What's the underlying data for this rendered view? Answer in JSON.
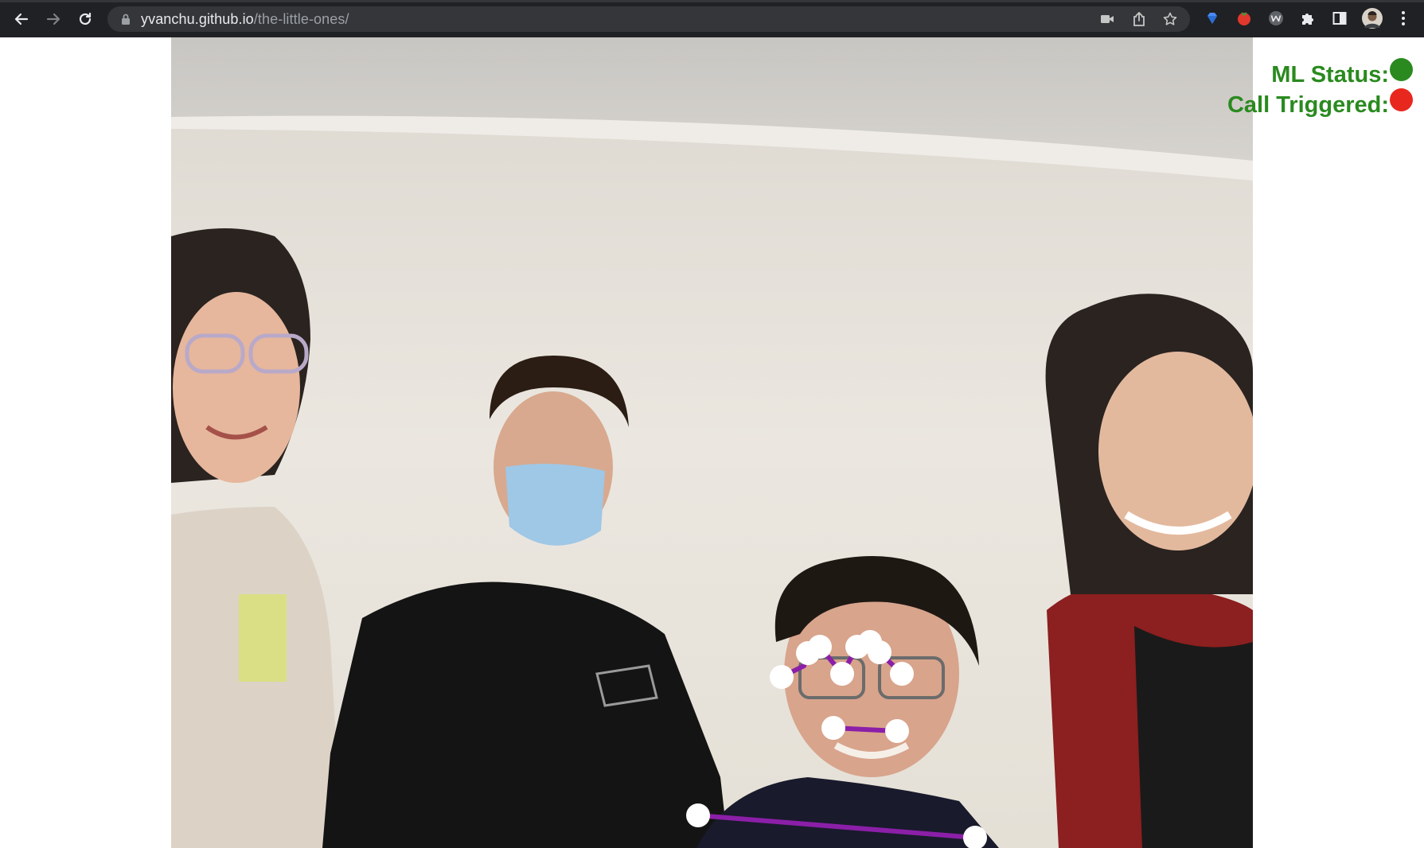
{
  "browser": {
    "url_host": "yvanchu.github.io",
    "url_path": "/the-little-ones/"
  },
  "icons": {
    "back": "arrow-left-icon",
    "forward": "arrow-right-icon",
    "reload": "reload-icon",
    "lock": "lock-icon",
    "camera": "camera-icon",
    "share": "share-icon",
    "bookmark": "star-icon",
    "extensions": "puzzle-icon",
    "side_panel": "side-panel-icon",
    "menu": "kebab-menu-icon"
  },
  "status": {
    "ml_label": "ML Status:",
    "ml_color": "#2a8a1f",
    "call_label": "Call Triggered:",
    "call_color": "#e8281f",
    "label_color": "#2a8a1f"
  },
  "overlay": {
    "line_color": "#8b1fa8",
    "point_color": "#ffffff"
  }
}
